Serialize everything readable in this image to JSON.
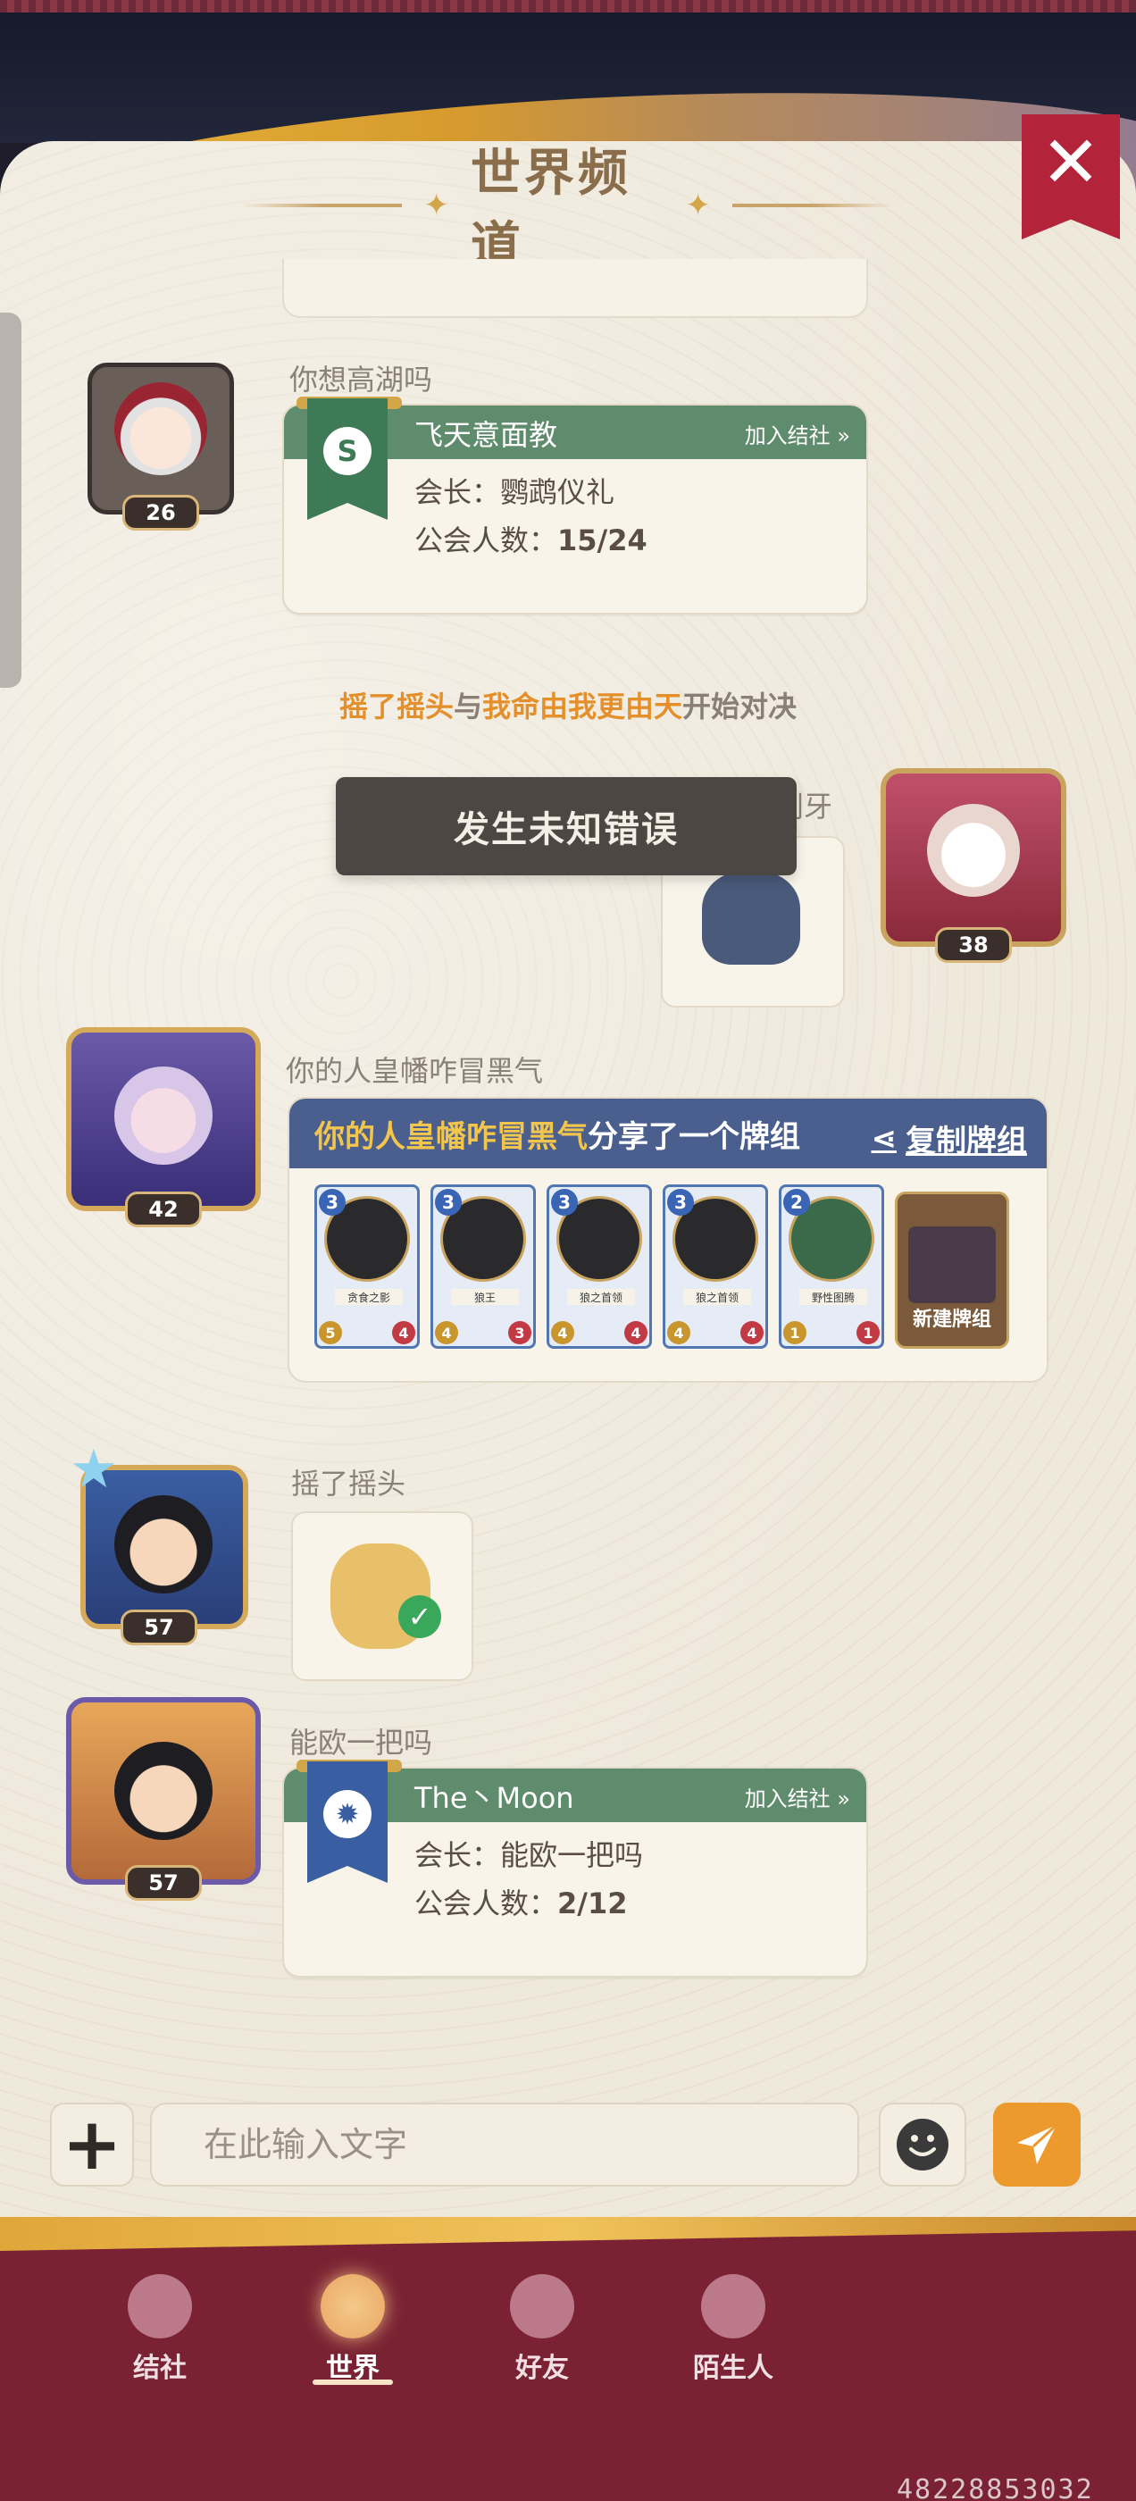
{
  "window": {
    "title": "世界频道"
  },
  "messages": {
    "guild1": {
      "sender": "你想高湖吗",
      "level": "26",
      "guild_name": "飞天意面教",
      "join_label": "加入结社 »",
      "leader_label": "会长：",
      "leader_name": "鹦鹉仪礼",
      "members_label": "公会人数：",
      "members_value": "15/24"
    },
    "system": {
      "player1": "摇了摇头",
      "connector": "与",
      "player2": "我命由我更由天",
      "action": "开始对决"
    },
    "toast": "发生未知错误",
    "sticker1": {
      "sender_partial": "刹牙",
      "level": "38"
    },
    "deck_share": {
      "sender": "你的人皇幡咋冒黑气",
      "level": "42",
      "share_user": "你的人皇幡咋冒黑气",
      "share_text": "分享了一个牌组",
      "copy_label": "复制牌组",
      "cards": [
        {
          "name": "贪食之影",
          "cost": "3",
          "atk": "5",
          "hp": "4"
        },
        {
          "name": "狼王",
          "cost": "3",
          "atk": "4",
          "hp": "3"
        },
        {
          "name": "狼之首领",
          "cost": "3",
          "atk": "4",
          "hp": "4"
        },
        {
          "name": "狼之首领",
          "cost": "3",
          "atk": "4",
          "hp": "4"
        },
        {
          "name": "野性图腾",
          "cost": "2",
          "atk": "1",
          "hp": "1"
        }
      ],
      "new_deck_label": "新建牌组"
    },
    "sticker2": {
      "sender": "摇了摇头",
      "level": "57"
    },
    "guild2": {
      "sender": "能欧一把吗",
      "level": "57",
      "guild_name": "The丶Moon",
      "join_label": "加入结社 »",
      "leader_label": "会长：",
      "leader_name": "能欧一把吗",
      "members_label": "公会人数：",
      "members_value": "2/12"
    }
  },
  "input": {
    "placeholder": "在此输入文字"
  },
  "nav": {
    "items": [
      {
        "label": "结社",
        "icon": "guild-icon"
      },
      {
        "label": "世界",
        "icon": "globe-icon"
      },
      {
        "label": "好友",
        "icon": "handshake-icon"
      },
      {
        "label": "陌生人",
        "icon": "stranger-icon"
      }
    ],
    "active": "世界"
  },
  "footer_id": "48228853032",
  "colors": {
    "accent": "#ec9a2e",
    "guild_header": "#5f8c6c",
    "share_header": "#4b5f8e",
    "close_button": "#b3233a",
    "nav_background": "#7a2233"
  }
}
